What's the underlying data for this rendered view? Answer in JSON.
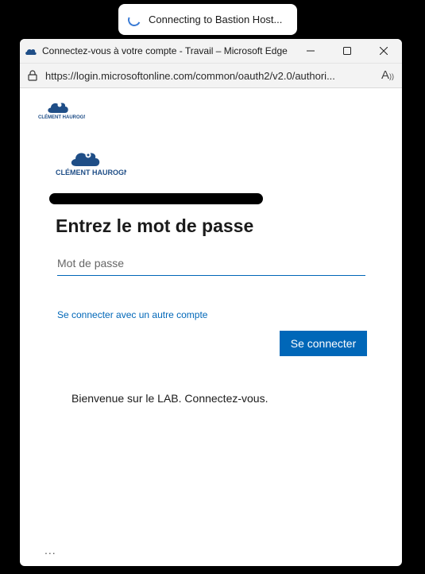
{
  "toast": {
    "text": "Connecting to Bastion Host..."
  },
  "window": {
    "title": "Connectez-vous à votre compte - Travail – Microsoft Edge",
    "url": "https://login.microsoftonline.com/common/oauth2/v2.0/authori...",
    "icons": {
      "app": "edge-cloud-icon",
      "minimize": "minimize-icon",
      "maximize": "maximize-icon",
      "close": "close-icon",
      "lock": "lock-icon",
      "read_aloud": "read-aloud-icon"
    }
  },
  "brand": {
    "name": "CLÉMENT HAUROGNÉ",
    "color": "#1f4e87"
  },
  "login": {
    "heading": "Entrez le mot de passe",
    "password_placeholder": "Mot de passe",
    "other_account_link": "Se connecter avec un autre compte",
    "sign_in_button": "Se connecter",
    "welcome_message": "Bienvenue sur le LAB. Connectez-vous.",
    "more_options": "..."
  },
  "colors": {
    "accent": "#0067b8",
    "titlebar": "#f3f3f3"
  }
}
